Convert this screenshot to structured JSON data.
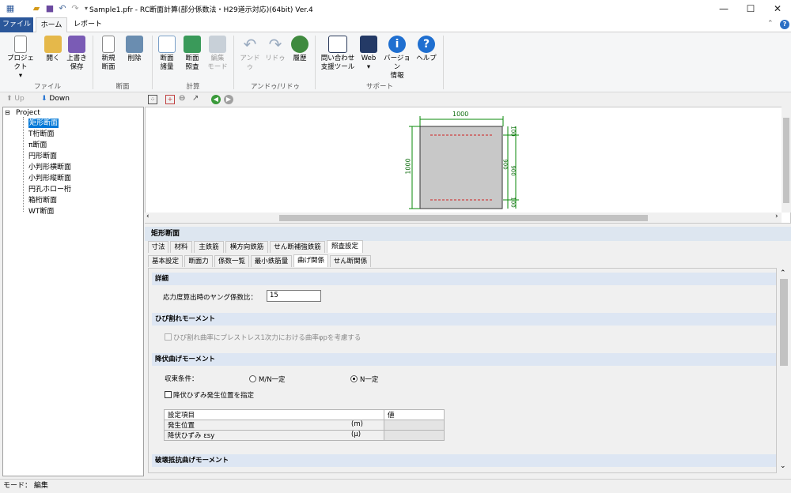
{
  "window": {
    "title": "Sample1.pfr - RC断面計算(部分係数法・H29道示対応)(64bit) Ver.4",
    "minimize": "—",
    "maximize": "☐",
    "close": "✕"
  },
  "ribbon_tabs": {
    "file": "ファイル",
    "home": "ホーム",
    "report": "レポート"
  },
  "ribbon": {
    "project": "プロジェクト",
    "open": "開く",
    "save1": "上書き",
    "save2": "保存",
    "new1": "新規",
    "new2": "断面",
    "delete": "削除",
    "sec_amount1": "断面",
    "sec_amount2": "諸量",
    "sec_check1": "断面",
    "sec_check2": "照査",
    "edit_mode1": "編集",
    "edit_mode2": "モード",
    "undo": "アンドゥ",
    "redo": "リドゥ",
    "history": "履歴",
    "inquiry1": "問い合わせ",
    "inquiry2": "支援ツール",
    "web": "Web",
    "version1": "バージョン",
    "version2": "情報",
    "help": "ヘルプ",
    "group_file": "ファイル",
    "group_section": "断面",
    "group_calc": "計算",
    "group_undo": "アンドゥ/リドゥ",
    "group_support": "サポート",
    "accent": "#2b579a"
  },
  "nav": {
    "up": "Up",
    "down": "Down"
  },
  "tree": {
    "root": "Project",
    "items": [
      "矩形断面",
      "T桁断面",
      "π断面",
      "円形断面",
      "小判形横断面",
      "小判形縦断面",
      "円孔ホロー桁",
      "箱桁断面",
      "WT断面"
    ]
  },
  "drawing": {
    "width": "1000",
    "height": "1000",
    "top_cover": "100",
    "bottom_cover": "100",
    "mid_dim": "900",
    "right_dim": "900"
  },
  "panel": {
    "title": "矩形断面",
    "tabs1": [
      "寸法",
      "材料",
      "主鉄筋",
      "横方向鉄筋",
      "せん断補強鉄筋",
      "照査設定"
    ],
    "tabs2": [
      "基本設定",
      "断面力",
      "係数一覧",
      "最小鉄筋量",
      "曲げ関係",
      "せん断関係"
    ]
  },
  "detail": {
    "header": "詳細",
    "young_label": "応力度算出時のヤング係数比：",
    "young_value": "15"
  },
  "crack": {
    "header": "ひび割れモーメント",
    "checkbox_label": "ひび割れ曲率にプレストレス1次力における曲率φpを考慮する"
  },
  "yield": {
    "header": "降伏曲げモーメント",
    "cond_label": "収束条件：",
    "opt1": "M/N一定",
    "opt2": "N一定",
    "checkbox_label": "降伏ひずみ発生位置を指定",
    "table": {
      "h1": "設定項目",
      "h2": "値",
      "rows": [
        {
          "label": "発生位置",
          "unit": "(m)",
          "value": ""
        },
        {
          "label": "降伏ひずみ εsy",
          "unit": "(μ)",
          "value": ""
        }
      ]
    }
  },
  "ultimate": {
    "header": "破壊抵抗曲げモーメント"
  },
  "status": {
    "text": "モード：  編集"
  }
}
